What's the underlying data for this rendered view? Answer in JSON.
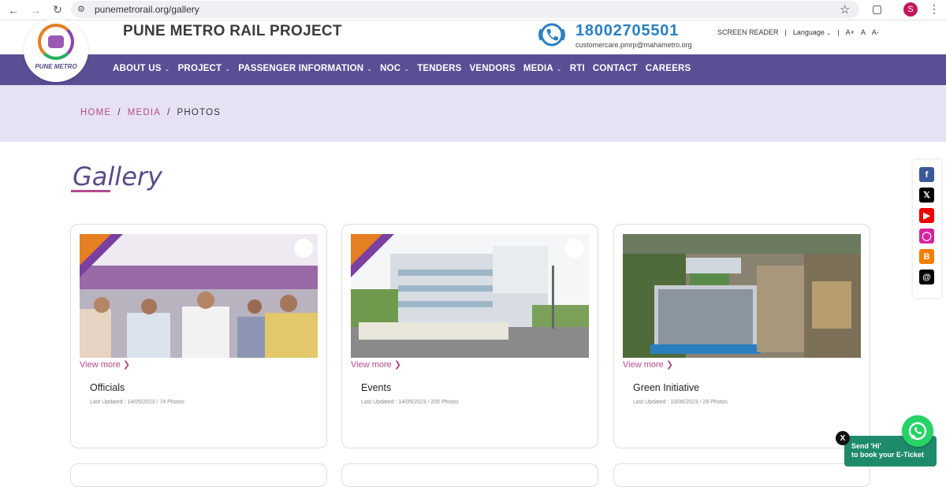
{
  "browser": {
    "url": "punemetrorail.org/gallery",
    "profile_initial": "S"
  },
  "header": {
    "logo_text": "PUNE METRO",
    "site_title": "PUNE METRO RAIL PROJECT",
    "phone": "18002705501",
    "email": "customercare.pmrp@mahametro.org",
    "screen_reader": "SCREEN READER",
    "language": "Language",
    "font_increase": "A+",
    "font_normal": "A",
    "font_decrease": "A-"
  },
  "nav": {
    "items": [
      {
        "label": "ABOUT US",
        "dropdown": true
      },
      {
        "label": "PROJECT",
        "dropdown": true
      },
      {
        "label": "PASSENGER INFORMATION",
        "dropdown": true
      },
      {
        "label": "NOC",
        "dropdown": true
      },
      {
        "label": "TENDERS",
        "dropdown": false
      },
      {
        "label": "VENDORS",
        "dropdown": false
      },
      {
        "label": "MEDIA",
        "dropdown": true
      },
      {
        "label": "RTI",
        "dropdown": false
      },
      {
        "label": "CONTACT",
        "dropdown": false
      },
      {
        "label": "CAREERS",
        "dropdown": false
      }
    ]
  },
  "breadcrumb": {
    "home": "HOME",
    "media": "MEDIA",
    "current": "PHOTOS",
    "separator": "/"
  },
  "page": {
    "heading": "Gallery"
  },
  "gallery": {
    "view_more": "View more",
    "cards": [
      {
        "title": "Officials",
        "meta": "Last Updated : 14/05/2023 / 74 Photos"
      },
      {
        "title": "Events",
        "meta": "Last Updated : 14/05/2023 / 205 Photos"
      },
      {
        "title": "Green Initiative",
        "meta": "Last Updated : 10/06/2023 / 29 Photos"
      }
    ]
  },
  "social": [
    "facebook-icon",
    "x-icon",
    "youtube-icon",
    "instagram-icon",
    "blogger-icon",
    "threads-icon"
  ],
  "whatsapp": {
    "close": "X",
    "line1": "Send 'Hi'",
    "line2": "to book your E-Ticket"
  },
  "colors": {
    "nav_bg": "#5a4f95",
    "crumb_bg": "#e7e2f3",
    "accent_pink": "#b34a8c",
    "phone_blue": "#2a7fc1",
    "whatsapp_green": "#1f8a6b"
  }
}
